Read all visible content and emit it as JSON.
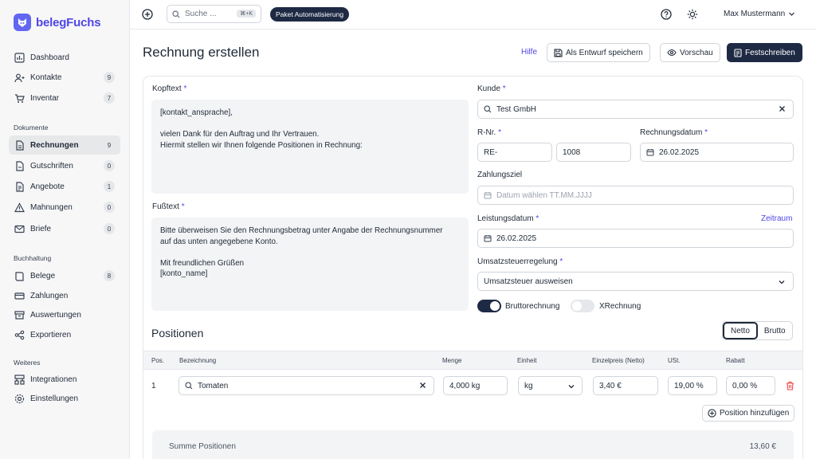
{
  "app": {
    "name": "belegFuchs"
  },
  "sidebar": {
    "items": [
      {
        "label": "Dashboard",
        "icon": "dashboard-icon",
        "badge": ""
      },
      {
        "label": "Kontakte",
        "icon": "contacts-icon",
        "badge": "9"
      },
      {
        "label": "Inventar",
        "icon": "cart-icon",
        "badge": "7"
      }
    ],
    "sections": [
      {
        "label": "Dokumente",
        "items": [
          {
            "label": "Rechnungen",
            "badge": "9",
            "active": true
          },
          {
            "label": "Gutschriften",
            "badge": "0"
          },
          {
            "label": "Angebote",
            "badge": "1"
          },
          {
            "label": "Mahnungen",
            "badge": "0"
          },
          {
            "label": "Briefe",
            "badge": "0"
          }
        ]
      },
      {
        "label": "Buchhaltung",
        "items": [
          {
            "label": "Belege",
            "badge": "8"
          },
          {
            "label": "Zahlungen",
            "badge": ""
          },
          {
            "label": "Auswertungen",
            "badge": ""
          },
          {
            "label": "Exportieren",
            "badge": ""
          }
        ]
      },
      {
        "label": "Weiteres",
        "items": [
          {
            "label": "Integrationen",
            "badge": ""
          },
          {
            "label": "Einstellungen",
            "badge": ""
          }
        ]
      }
    ]
  },
  "topbar": {
    "search_placeholder": "Suche ...",
    "shortcut": "⌘+K",
    "pill": "Paket Automatisierung",
    "user": "Max Mustermann"
  },
  "page": {
    "title": "Rechnung erstellen",
    "help": "Hilfe",
    "save_draft": "Als Entwurf speichern",
    "preview": "Vorschau",
    "finalize": "Festschreiben"
  },
  "form": {
    "header_label": "Kopftext",
    "header_text": "[kontakt_ansprache],\n\nvielen Dank für den Auftrag und Ihr Vertrauen.\nHiermit stellen wir Ihnen folgende Positionen in Rechnung:",
    "footer_label": "Fußtext",
    "footer_text": "Bitte überweisen Sie den Rechnungsbetrag unter Angabe der Rechnungsnummer\nauf das unten angegebene Konto.\n\nMit freundlichen Grüßen\n[konto_name]",
    "customer_label": "Kunde",
    "customer_value": "Test GmbH",
    "rnr_label": "R-Nr.",
    "rnr_prefix": "RE-",
    "rnr_number": "1008",
    "date_label": "Rechnungsdatum",
    "date_value": "26.02.2025",
    "due_label": "Zahlungsziel",
    "due_placeholder": "Datum wählen TT.MM.JJJJ",
    "service_label": "Leistungsdatum",
    "service_value": "26.02.2025",
    "service_link": "Zeitraum",
    "tax_label": "Umsatzsteuerregelung",
    "tax_value": "Umsatzsteuer ausweisen",
    "toggle_gross": "Bruttorechnung",
    "toggle_gross_on": true,
    "toggle_x": "XRechnung",
    "toggle_x_on": false,
    "required_mark": "*"
  },
  "positions": {
    "title": "Positionen",
    "netto": "Netto",
    "brutto": "Brutto",
    "headers": [
      "Pos.",
      "Bezeichnung",
      "Menge",
      "Einheit",
      "Einzelpreis (Netto)",
      "USt.",
      "Rabatt"
    ],
    "rows": [
      {
        "pos": "1",
        "name": "Tomaten",
        "qty": "4,000 kg",
        "unit": "kg",
        "price": "3,40 €",
        "tax": "19,00 %",
        "discount": "0,00 %"
      }
    ],
    "add": "Position hinzufügen",
    "sum_label": "Summe Positionen",
    "sum_value": "13,60 €"
  },
  "colors": {
    "accent": "#4f46e5",
    "dark": "#1e2a44"
  }
}
